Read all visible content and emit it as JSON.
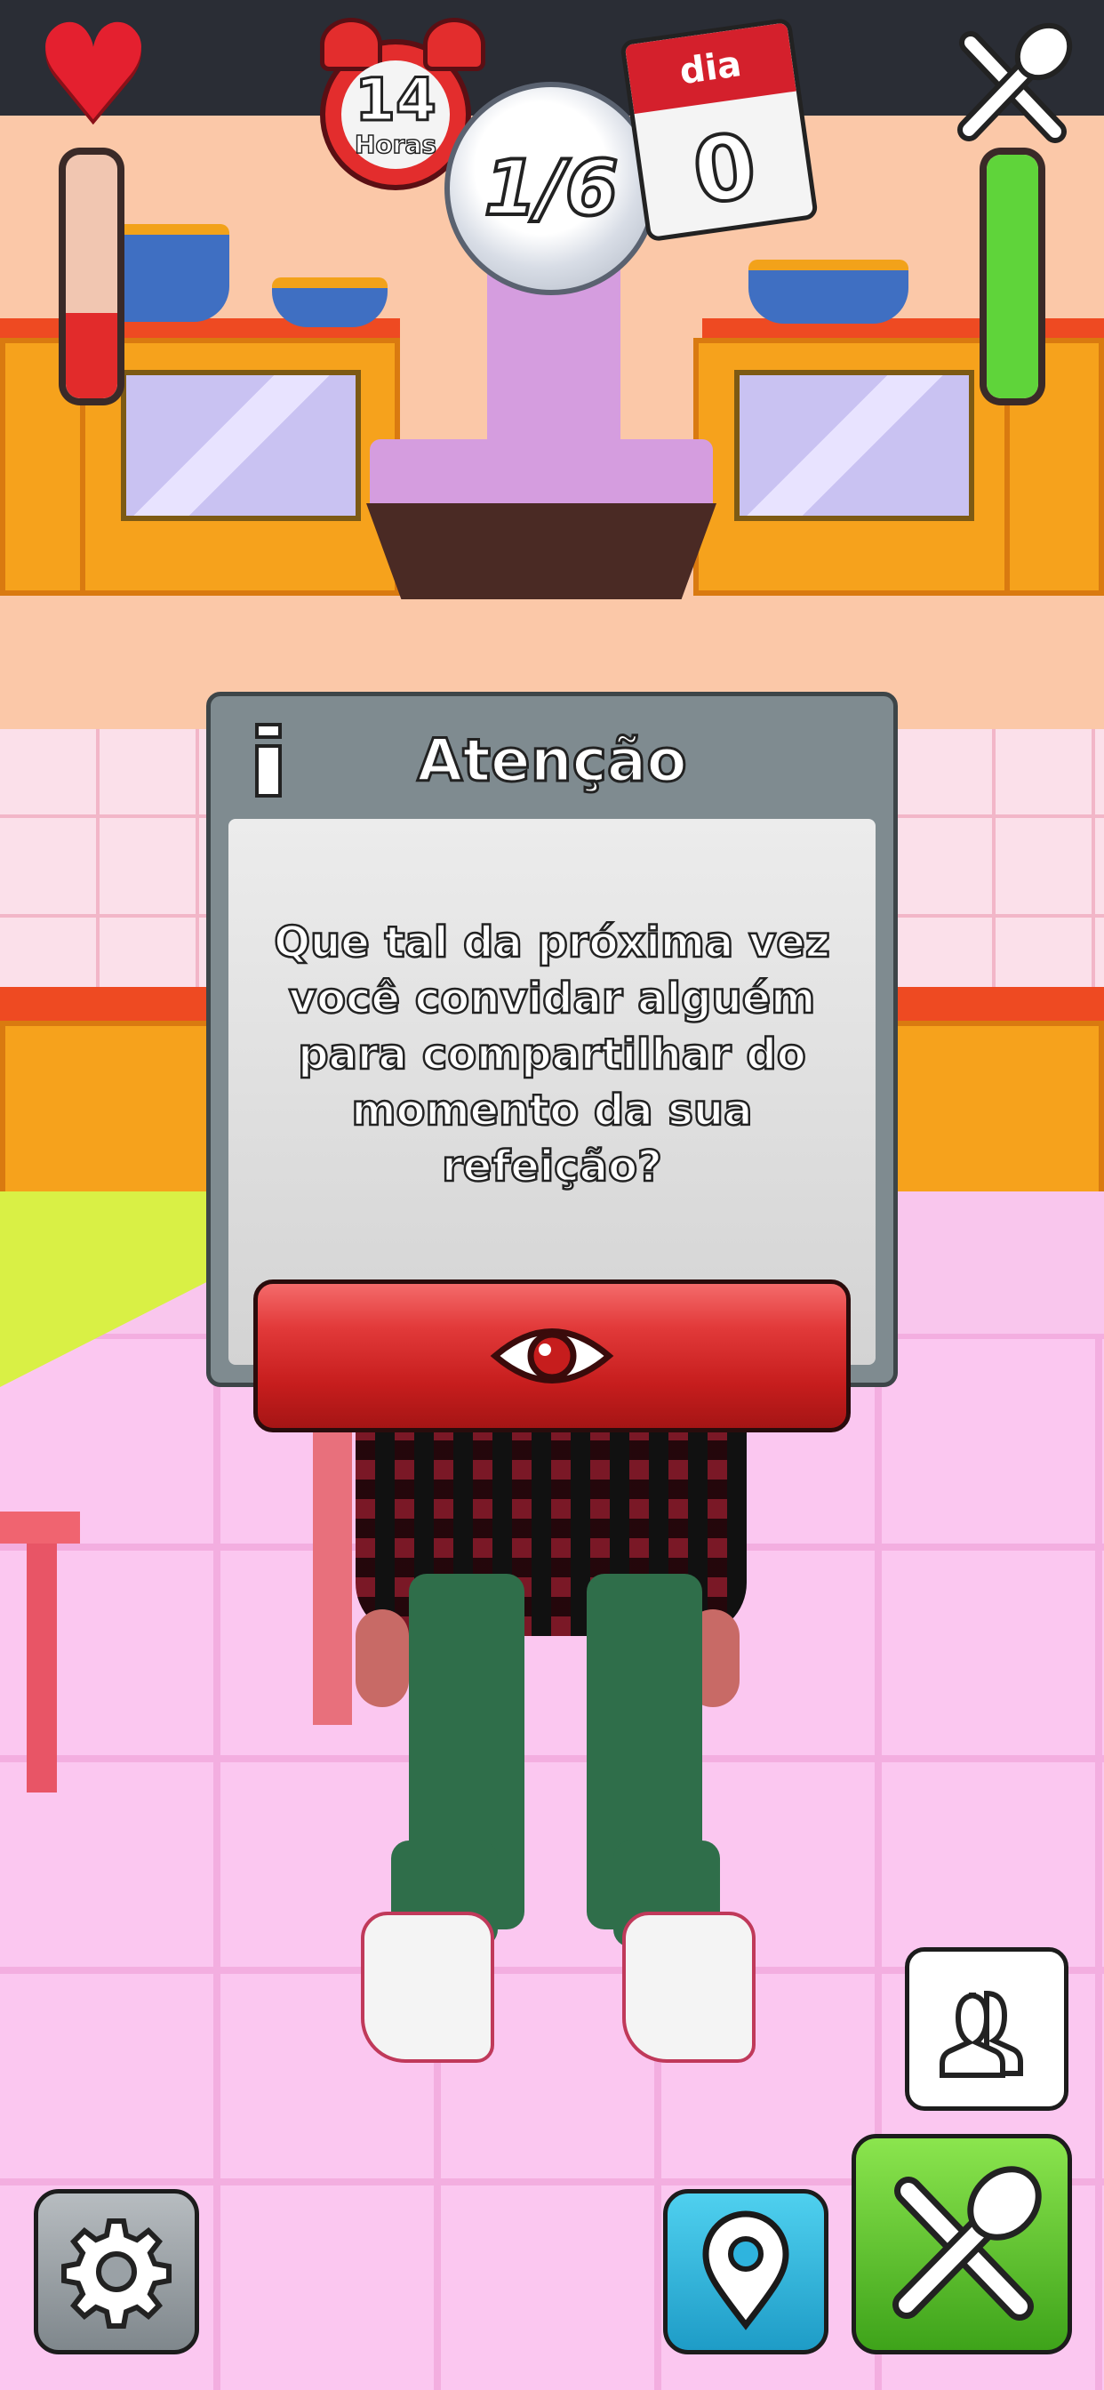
{
  "hud": {
    "clock_hours_value": "14",
    "clock_hours_label": "Horas",
    "plate_progress": "1/6",
    "calendar_label": "dia",
    "calendar_day": "0",
    "health_level": 0.35,
    "food_level": 1.0
  },
  "dialog": {
    "title": "Atenção",
    "message": "Que tal da próxima vez você convidar alguém para compartilhar do momento da sua refeição?",
    "action_button_icon": "eye-icon"
  },
  "bottom_controls": {
    "settings_icon": "gear-icon",
    "location_icon": "map-pin-icon",
    "meal_icon": "fork-spoon-icon",
    "social_icon": "people-icon"
  },
  "colors": {
    "health": "#e22b2b",
    "food": "#5fd43a",
    "dialog_button": "#d42a2a",
    "location_button": "#2fb4de",
    "meal_button": "#56c229"
  }
}
